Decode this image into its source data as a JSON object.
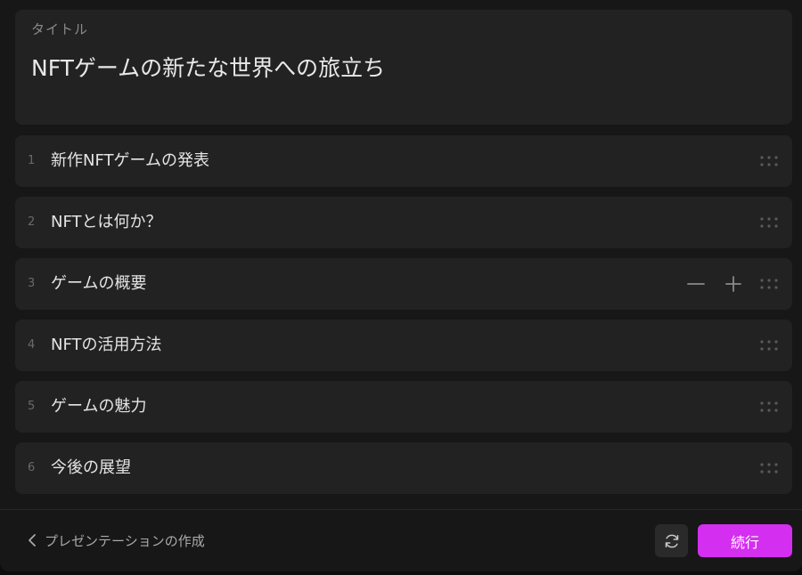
{
  "title_section": {
    "label": "タイトル",
    "value": "NFTゲームの新たな世界への旅立ち"
  },
  "outline": {
    "items": [
      {
        "number": "1",
        "text": "新作NFTゲームの発表"
      },
      {
        "number": "2",
        "text": "NFTとは何か？"
      },
      {
        "number": "3",
        "text": "ゲームの概要",
        "controls": [
          "minus-icon",
          "plus-icon"
        ]
      },
      {
        "number": "4",
        "text": "NFTの活用方法"
      },
      {
        "number": "5",
        "text": "ゲームの魅力"
      },
      {
        "number": "6",
        "text": "今後の展望"
      }
    ]
  },
  "footer": {
    "back_label": "プレゼンテーションの作成",
    "continue_label": "続行"
  },
  "colors": {
    "background": "#171717",
    "card": "#222222",
    "accent": "#d42ef0"
  },
  "icons": {
    "back": "chevron-left-icon",
    "refresh": "refresh-icon",
    "drag": "drag-handle-icon"
  }
}
